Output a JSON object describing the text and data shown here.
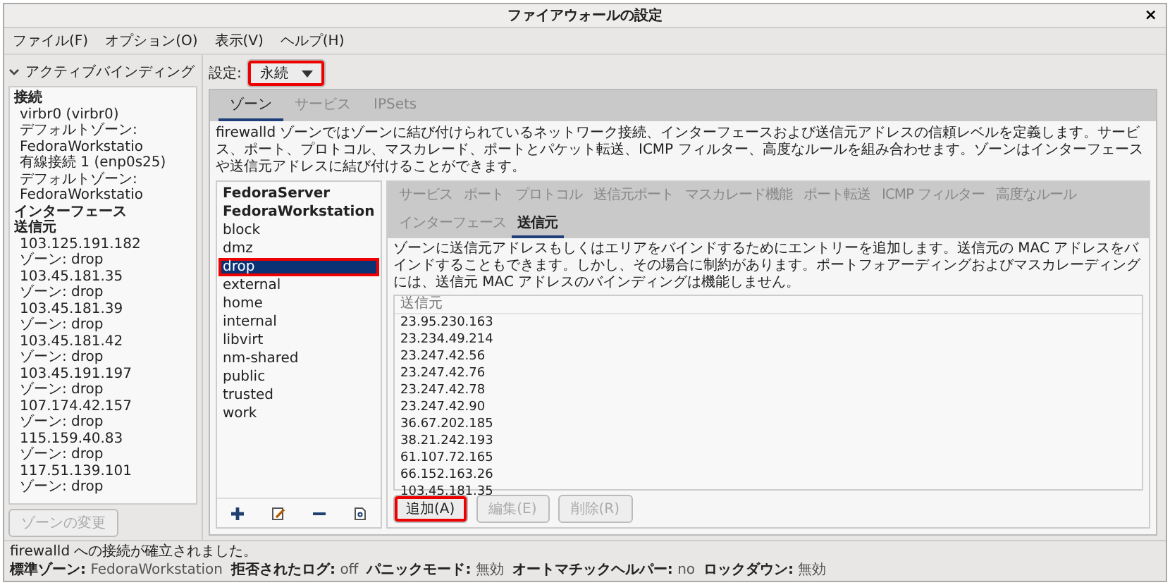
{
  "window": {
    "title": "ファイアウォールの設定",
    "close": "×"
  },
  "menu": [
    "ファイル(F)",
    "オプション(O)",
    "表示(V)",
    "ヘルプ(H)"
  ],
  "active_bindings": {
    "title": "アクティブバインディング",
    "expanded": true,
    "sections": [
      {
        "heading": "接続",
        "items": [
          {
            "name": "virbr0 (virbr0)",
            "zone": "デフォルトゾーン: FedoraWorkstatio"
          },
          {
            "name": "有線接続 1 (enp0s25)",
            "zone": "デフォルトゾーン: FedoraWorkstatio"
          }
        ]
      },
      {
        "heading": "インターフェース"
      },
      {
        "heading": "送信元",
        "items": [
          {
            "name": "103.125.191.182",
            "zone": "ゾーン: drop"
          },
          {
            "name": "103.45.181.35",
            "zone": "ゾーン: drop"
          },
          {
            "name": "103.45.181.39",
            "zone": "ゾーン: drop"
          },
          {
            "name": "103.45.181.42",
            "zone": "ゾーン: drop"
          },
          {
            "name": "103.45.191.197",
            "zone": "ゾーン: drop"
          },
          {
            "name": "107.174.42.157",
            "zone": "ゾーン: drop"
          },
          {
            "name": "115.159.40.83",
            "zone": "ゾーン: drop"
          },
          {
            "name": "117.51.139.101",
            "zone": "ゾーン: drop"
          }
        ]
      }
    ]
  },
  "change_zone_button": {
    "label": "ゾーンの変更",
    "disabled": true
  },
  "config": {
    "label": "設定:",
    "value": "永続",
    "highlighted": true
  },
  "zone_tabs": [
    {
      "label": "ゾーン",
      "selected": true
    },
    {
      "label": "サービス",
      "selected": false
    },
    {
      "label": "IPSets",
      "selected": false
    }
  ],
  "zone_description": "firewalld ゾーンではゾーンに結び付けられているネットワーク接続、インターフェースおよび送信元アドレスの信頼レベルを定義します。サービス、ポート、プロトコル、マスカレード、ポートとパケット転送、ICMP フィルター、高度なルールを組み合わせます。ゾーンはインターフェースや送信元アドレスに結び付けることができます。",
  "zones": [
    {
      "name": "FedoraServer",
      "bold": true,
      "selected": false,
      "highlighted": false
    },
    {
      "name": "FedoraWorkstation",
      "bold": true,
      "selected": false,
      "highlighted": false
    },
    {
      "name": "block",
      "bold": false,
      "selected": false,
      "highlighted": false
    },
    {
      "name": "dmz",
      "bold": false,
      "selected": false,
      "highlighted": false
    },
    {
      "name": "drop",
      "bold": false,
      "selected": true,
      "highlighted": true
    },
    {
      "name": "external",
      "bold": false,
      "selected": false,
      "highlighted": false
    },
    {
      "name": "home",
      "bold": false,
      "selected": false,
      "highlighted": false
    },
    {
      "name": "internal",
      "bold": false,
      "selected": false,
      "highlighted": false
    },
    {
      "name": "libvirt",
      "bold": false,
      "selected": false,
      "highlighted": false
    },
    {
      "name": "nm-shared",
      "bold": false,
      "selected": false,
      "highlighted": false
    },
    {
      "name": "public",
      "bold": false,
      "selected": false,
      "highlighted": false
    },
    {
      "name": "trusted",
      "bold": false,
      "selected": false,
      "highlighted": false
    },
    {
      "name": "work",
      "bold": false,
      "selected": false,
      "highlighted": false
    }
  ],
  "inner_tabs": [
    {
      "label": "サービス",
      "selected": false
    },
    {
      "label": "ポート",
      "selected": false
    },
    {
      "label": "プロトコル",
      "selected": false
    },
    {
      "label": "送信元ポート",
      "selected": false
    },
    {
      "label": "マスカレード機能",
      "selected": false
    },
    {
      "label": "ポート転送",
      "selected": false
    },
    {
      "label": "ICMP フィルター",
      "selected": false
    },
    {
      "label": "高度なルール",
      "selected": false
    },
    {
      "label": "インターフェース",
      "selected": false
    },
    {
      "label": "送信元",
      "selected": true
    }
  ],
  "sources_description": "ゾーンに送信元アドレスもしくはエリアをバインドするためにエントリーを追加します。送信元の MAC アドレスをバインドすることもできます。しかし、その場合に制約があります。ポートフォアーディングおよびマスカレーディングには、送信元 MAC アドレスのバインディングは機能しません。",
  "sources_table": {
    "column": "送信元",
    "rows": [
      "23.95.230.163",
      "23.234.49.214",
      "23.247.42.56",
      "23.247.42.76",
      "23.247.42.78",
      "23.247.42.90",
      "36.67.202.185",
      "38.21.242.193",
      "61.107.72.165",
      "66.152.163.26",
      "103.45.181.35"
    ]
  },
  "source_buttons": [
    {
      "label": "追加(A)",
      "disabled": false,
      "highlighted": true
    },
    {
      "label": "編集(E)",
      "disabled": true,
      "highlighted": false
    },
    {
      "label": "削除(R)",
      "disabled": true,
      "highlighted": false
    }
  ],
  "status_message": "firewalld への接続が確立されました。",
  "status_bar": [
    {
      "label": "標準ゾーン:",
      "value": "FedoraWorkstation"
    },
    {
      "label": "拒否されたログ:",
      "value": "off"
    },
    {
      "label": "パニックモード:",
      "value": "無効"
    },
    {
      "label": "オートマチックヘルパー:",
      "value": "no"
    },
    {
      "label": "ロックダウン:",
      "value": "無効"
    }
  ]
}
